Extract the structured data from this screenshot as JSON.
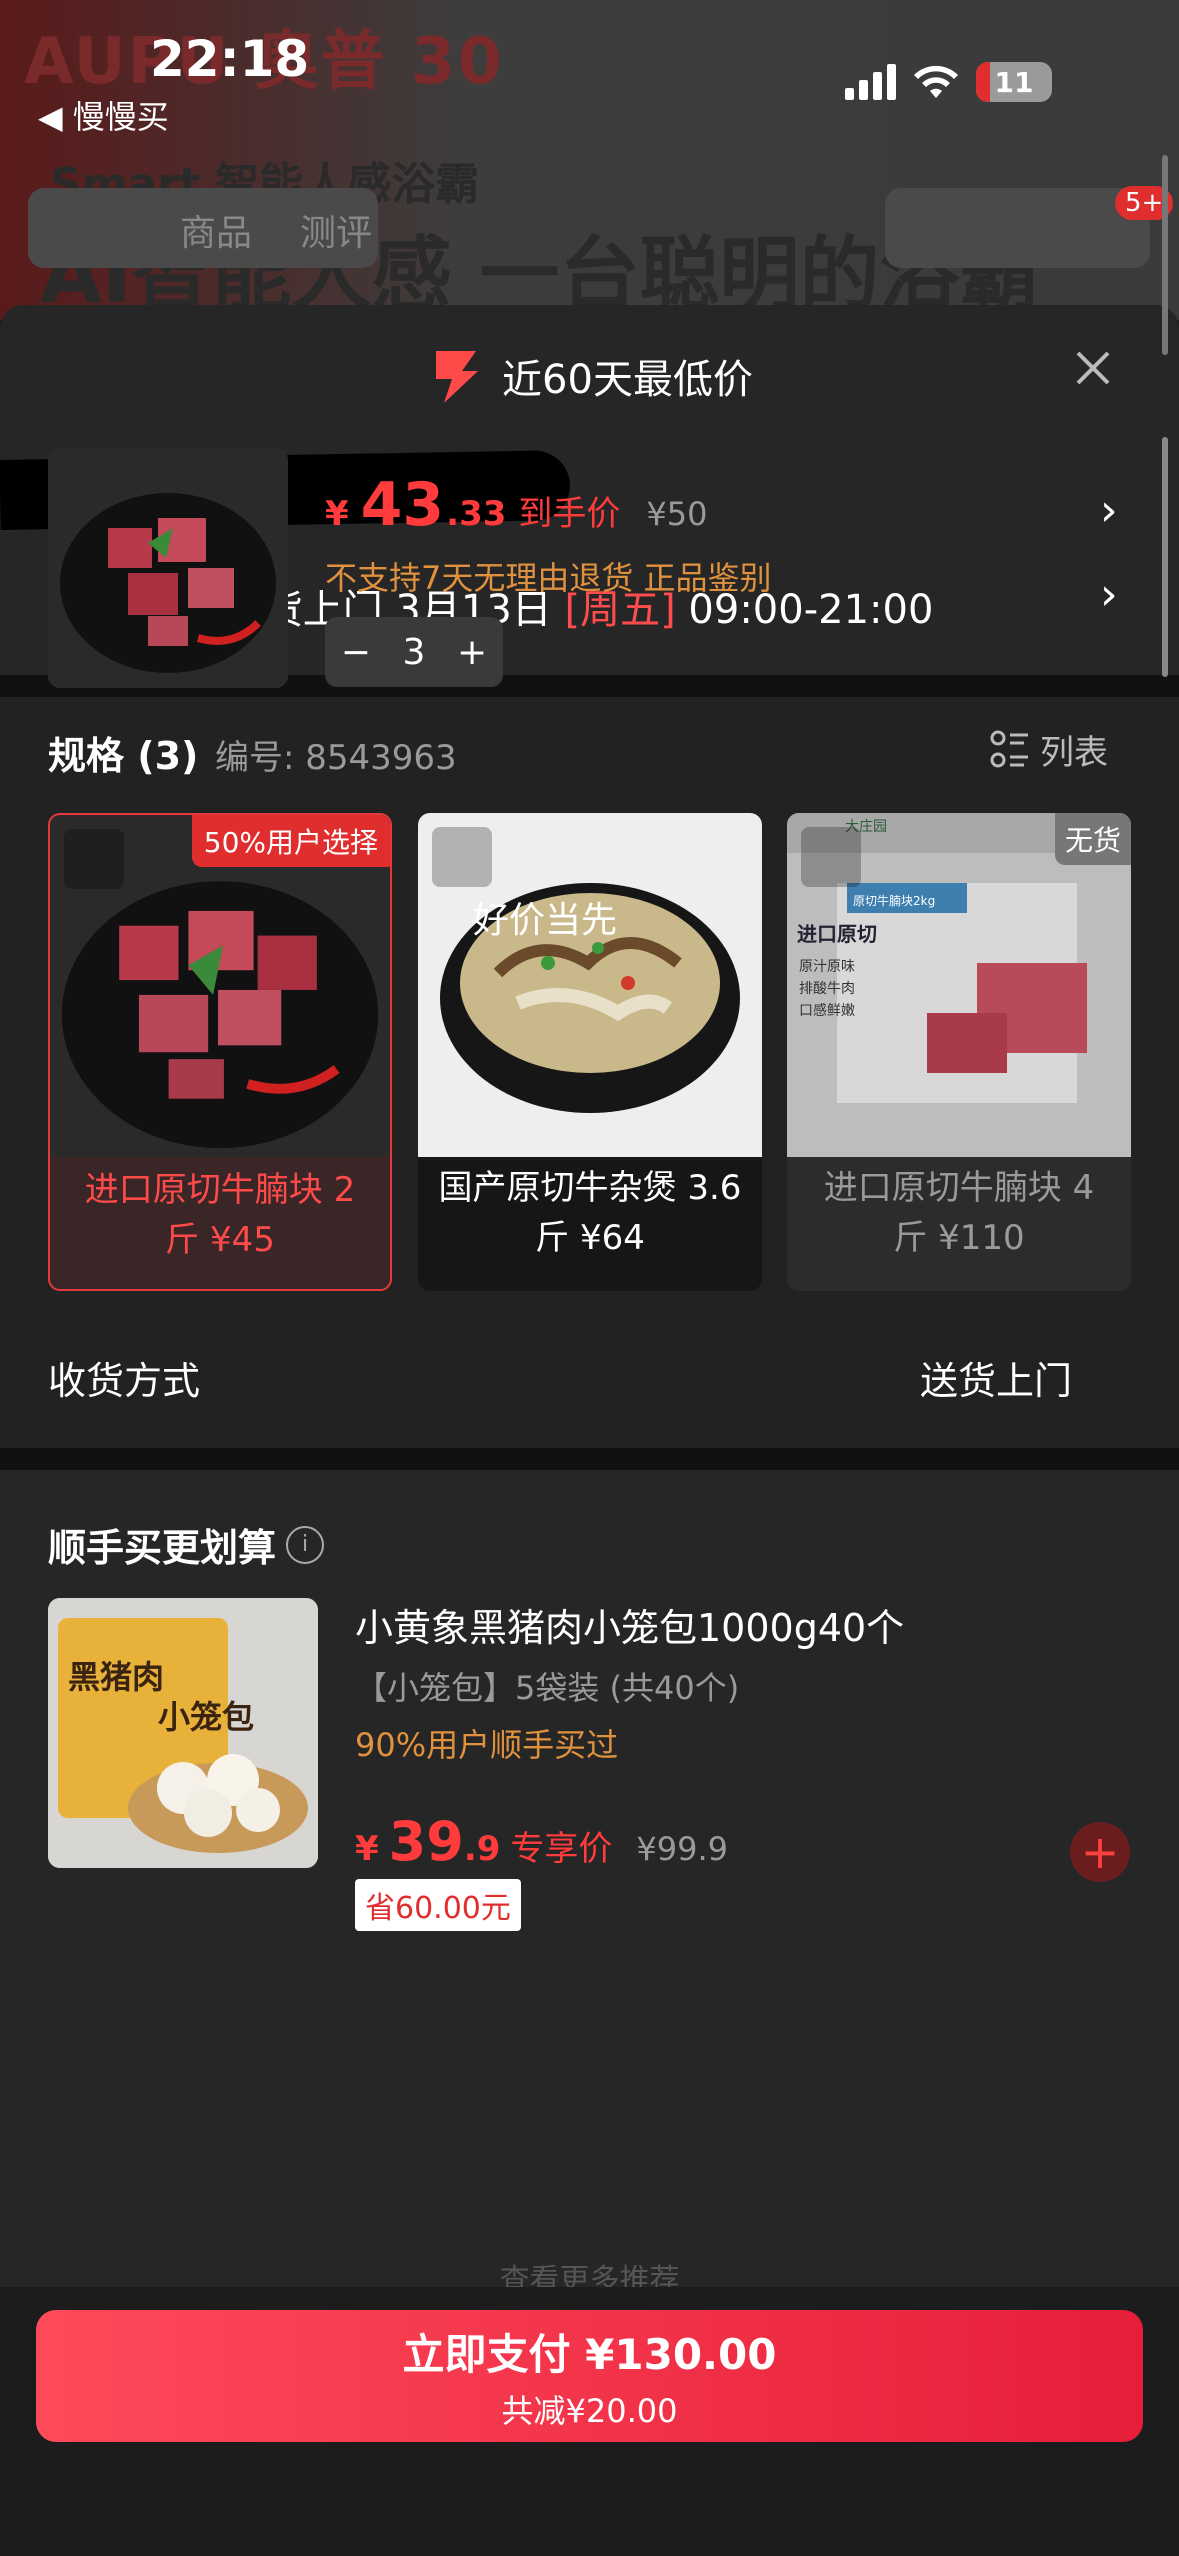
{
  "status_bar": {
    "time": "22:18",
    "back_app": "◀ 慢慢买",
    "battery": "11"
  },
  "background_page": {
    "brand": "AUPU 奥普 30",
    "product_line": "Smart 智能人感浴霸",
    "headline": "AI智能人感 一台聪明的浴霸",
    "tabs": [
      "商品",
      "测评"
    ],
    "cart_badge": "5+"
  },
  "sheet": {
    "lowest_price_label": "近60天最低价",
    "delivery": {
      "carrier": "京东快递 送货上门 3月13日 ",
      "weekday": "[周五]",
      "window": " 09:00-21:00"
    },
    "product": {
      "yen": "¥",
      "price_int": "43",
      "price_dec": ".33",
      "price_tag": "到手价",
      "orig_price": "¥50",
      "policy": "不支持7天无理由退货   正品鉴别",
      "qty_minus": "−",
      "qty": "3",
      "qty_plus": "+"
    },
    "spec": {
      "title": "规格 (3)",
      "number": "编号: 8543963",
      "list_label": "列表",
      "options": [
        {
          "label": "进口原切牛腩块 2斤 ¥45",
          "badge": "50%用户选择",
          "selected": true
        },
        {
          "label": "国产原切牛杂煲 3.6斤 ¥64",
          "overlay": "好价当先",
          "selected": false
        },
        {
          "label": "进口原切牛腩块 4斤 ¥110",
          "badge": "无货",
          "selected": false,
          "package_text": [
            "大庄园",
            "原切牛腩块2kg",
            "进口原切",
            "原汁原味",
            "排酸牛肉",
            "口感鲜嫩"
          ]
        }
      ]
    },
    "receive": {
      "label": "收货方式",
      "value": "送货上门"
    },
    "addon": {
      "title": "顺手买更划算",
      "item": {
        "name": "小黄象黑猪肉小笼包1000g40个",
        "spec": "【小笼包】5袋装 (共40个)",
        "stat": "90%用户顺手买过",
        "yen": "¥",
        "price_int": "39",
        "price_dec": ".9",
        "price_tag": "专享价",
        "orig_price": "¥99.9",
        "save": "省60.00元",
        "package_text": [
          "黑猪肉",
          "小笼包"
        ]
      },
      "more_hint": "查看更多推荐"
    },
    "pay": {
      "main": "立即支付 ¥130.00",
      "sub": "共减¥20.00"
    }
  },
  "colors": {
    "accent_red": "#ff3b3b",
    "orange": "#e0913e",
    "sheet_bg": "#222222"
  }
}
